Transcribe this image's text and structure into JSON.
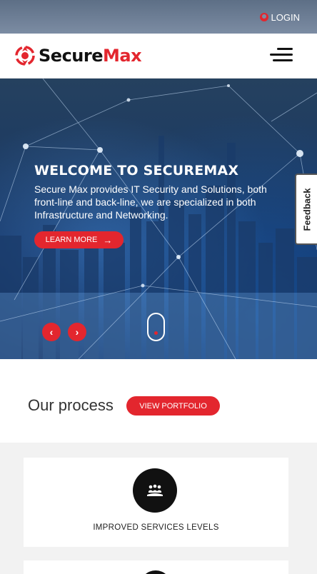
{
  "topbar": {
    "login_label": "LOGIN"
  },
  "header": {
    "brand_first": "Secure",
    "brand_second": "Max",
    "menu_icon": "hamburger-menu-icon"
  },
  "hero": {
    "title": "WELCOME TO SECUREMAX",
    "description": "Secure Max provides IT Security and Solutions, both front-line and back-line, we are specialized in both Infrastructure and Networking.",
    "cta_label": "LEARN MORE",
    "cta_icon": "arrow-right-icon",
    "feedback_label": "Feedback",
    "prev_icon": "chevron-left-icon",
    "next_icon": "chevron-right-icon"
  },
  "process": {
    "title": "Our process",
    "portfolio_label": "VIEW PORTFOLIO"
  },
  "cards": [
    {
      "label": "IMPROVED SERVICES LEVELS",
      "icon": "team-hand-icon"
    }
  ],
  "colors": {
    "accent": "#e3262e",
    "hero_bg": "#143262",
    "section_bg": "#f2f2f2"
  }
}
